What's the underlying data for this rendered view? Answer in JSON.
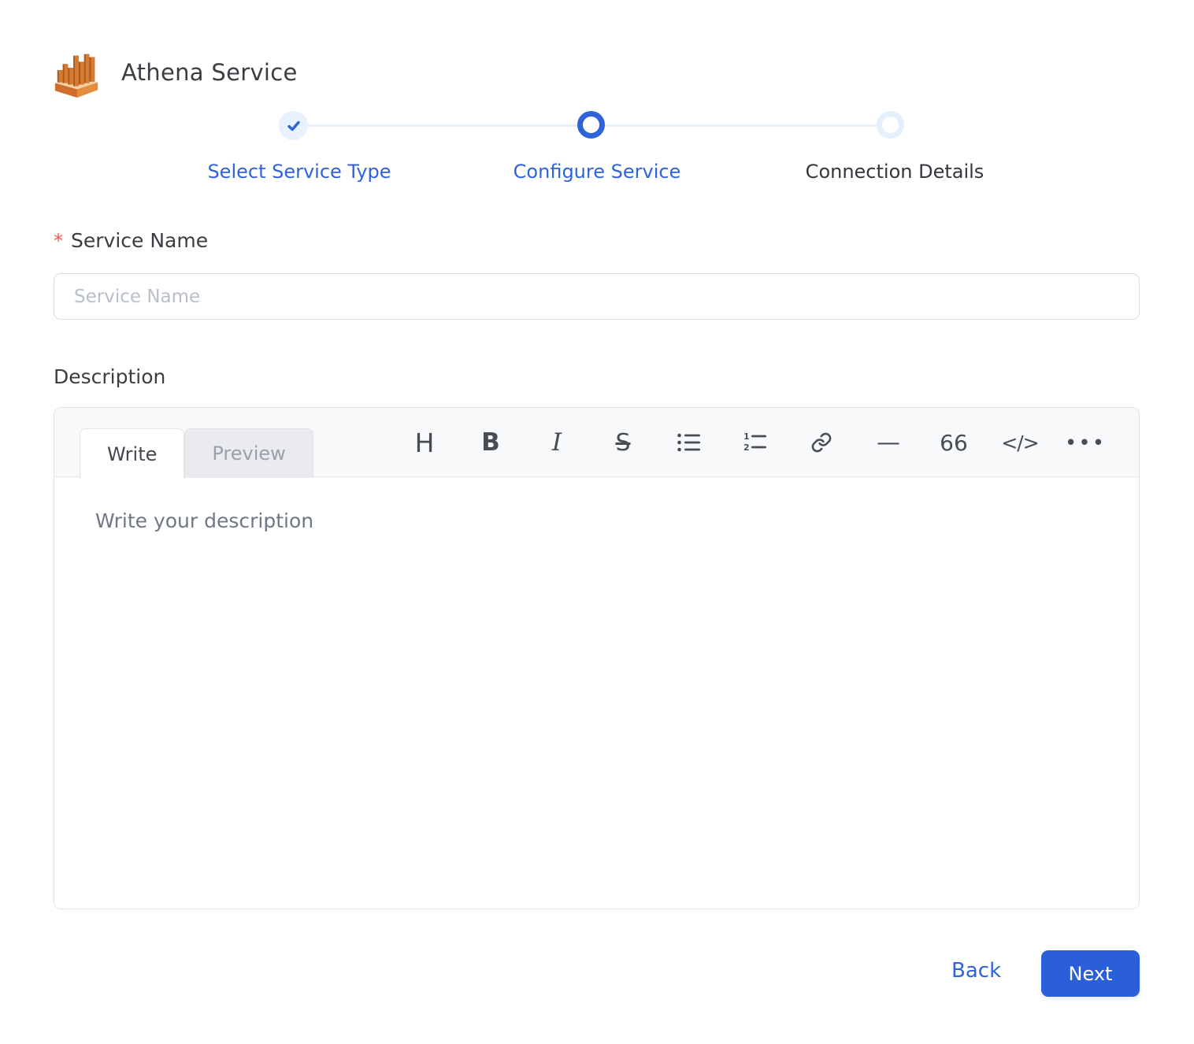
{
  "header": {
    "title": "Athena Service",
    "logo": "athena-logo"
  },
  "stepper": {
    "steps": [
      {
        "label": "Select Service Type",
        "state": "completed"
      },
      {
        "label": "Configure Service",
        "state": "active"
      },
      {
        "label": "Connection Details",
        "state": "pending"
      }
    ]
  },
  "form": {
    "service_name": {
      "label": "Service Name",
      "required_marker": "*",
      "placeholder": "Service Name",
      "value": ""
    },
    "description": {
      "label": "Description",
      "editor": {
        "tabs": [
          {
            "label": "Write",
            "active": true
          },
          {
            "label": "Preview",
            "active": false
          }
        ],
        "toolbar_glyphs": {
          "heading": "H",
          "bold": "B",
          "italic": "I",
          "strikethrough": "S",
          "horizontal_rule": "—",
          "quote": "66",
          "code": "</>",
          "more": "•••"
        },
        "placeholder": "Write your description",
        "value": ""
      }
    }
  },
  "footer": {
    "back_label": "Back",
    "next_label": "Next"
  },
  "colors": {
    "accent_blue": "#2e63d9",
    "inactive_step_blue": "#e4effd",
    "required_red": "#ee5a52",
    "toolbar_bg": "#f8f9fb",
    "athena_orange": "#d97a31"
  }
}
